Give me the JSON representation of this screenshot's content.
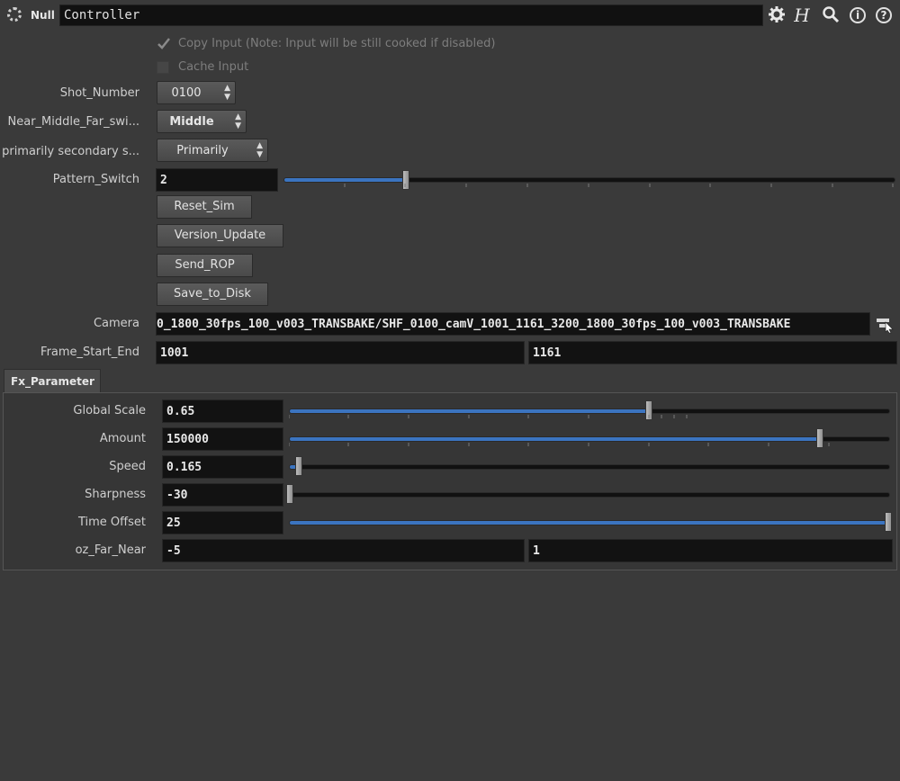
{
  "header": {
    "node_type": "Null",
    "node_name": "Controller",
    "icons": [
      "gear-icon",
      "help-h-icon",
      "search-icon",
      "info-icon",
      "question-icon"
    ]
  },
  "params": {
    "copy_input_label": "Copy Input (Note: Input will be still cooked if disabled)",
    "copy_input_checked": true,
    "cache_input_label": "Cache Input",
    "cache_input_checked": false,
    "shot_number": {
      "label": "Shot_Number",
      "value": "0100"
    },
    "near_middle_far": {
      "label": "Near_Middle_Far_swi...",
      "value": "Middle"
    },
    "primarily_secondary": {
      "label": "primarily secondary s...",
      "value": "Primarily"
    },
    "pattern_switch": {
      "label": "Pattern_Switch",
      "value": "2",
      "slider_fraction": 0.2
    },
    "buttons": [
      "Reset_Sim",
      "Version_Update",
      "Send_ROP",
      "Save_to_Disk"
    ],
    "camera": {
      "label": "Camera",
      "value": "0_1800_30fps_100_v003_TRANSBAKE/SHF_0100_camV_1001_1161_3200_1800_30fps_100_v003_TRANSBAKE"
    },
    "frame_start_end": {
      "label": "Frame_Start_End",
      "start": "1001",
      "end": "1161"
    }
  },
  "fx_tab": {
    "label": "Fx_Parameter",
    "rows": [
      {
        "label": "Global Scale",
        "value": "0.65",
        "slider_fraction": 0.6
      },
      {
        "label": "Amount",
        "value": "150000",
        "slider_fraction": 0.885
      },
      {
        "label": "Speed",
        "value": "0.165",
        "slider_fraction": 0.015
      },
      {
        "label": "Sharpness",
        "value": "-30",
        "slider_fraction": 0.0
      },
      {
        "label": "Time Offset",
        "value": "25",
        "slider_fraction": 1.0
      }
    ],
    "oz_far_near": {
      "label": "oz_Far_Near",
      "near": "-5",
      "far": "1"
    }
  },
  "colors": {
    "slider_fill": "#3b74c0",
    "field_bg": "#121212",
    "panel_bg": "#3a3a3a"
  }
}
